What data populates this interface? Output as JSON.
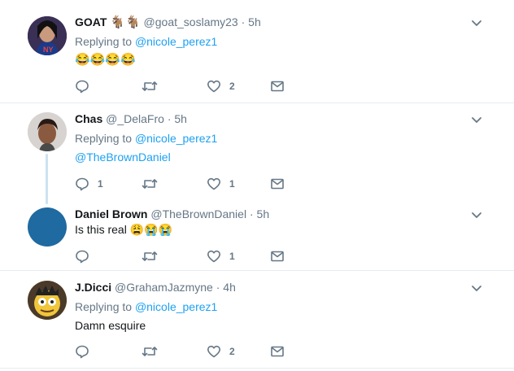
{
  "tweets": [
    {
      "name": "GOAT",
      "name_badges": "🐐🐐",
      "handle": "@goat_soslamy23",
      "dot": "·",
      "time": "5h",
      "replying_prefix": "Replying to",
      "replying_to": "@nicole_perez1",
      "text": "😂😂😂😂",
      "reply_count": "",
      "retweet_count": "",
      "like_count": "2"
    },
    {
      "name": "Chas",
      "handle": "@_DelaFro",
      "dot": "·",
      "time": "5h",
      "replying_prefix": "Replying to",
      "replying_to": "@nicole_perez1",
      "text": "@TheBrownDaniel",
      "reply_count": "1",
      "retweet_count": "",
      "like_count": "1"
    },
    {
      "name": "Daniel Brown",
      "handle": "@TheBrownDaniel",
      "dot": "·",
      "time": "5h",
      "text": "Is this real 😩😭😭",
      "reply_count": "",
      "retweet_count": "",
      "like_count": "1"
    },
    {
      "name": "J.Dicci",
      "handle": "@GrahamJazmyne",
      "dot": "·",
      "time": "4h",
      "replying_prefix": "Replying to",
      "replying_to": "@nicole_perez1",
      "text": "Damn esquire",
      "reply_count": "",
      "retweet_count": "",
      "like_count": "2"
    }
  ],
  "icons": {
    "reply": "reply-icon",
    "retweet": "retweet-icon",
    "like": "heart-icon",
    "dm": "envelope-icon",
    "more": "chevron-down-icon"
  },
  "colors": {
    "link": "#1da1f2",
    "secondary_text": "#657786",
    "divider": "#e6ecf0",
    "thread_line": "#cce3f0",
    "avatar_daniel": "#1f6aa0"
  }
}
